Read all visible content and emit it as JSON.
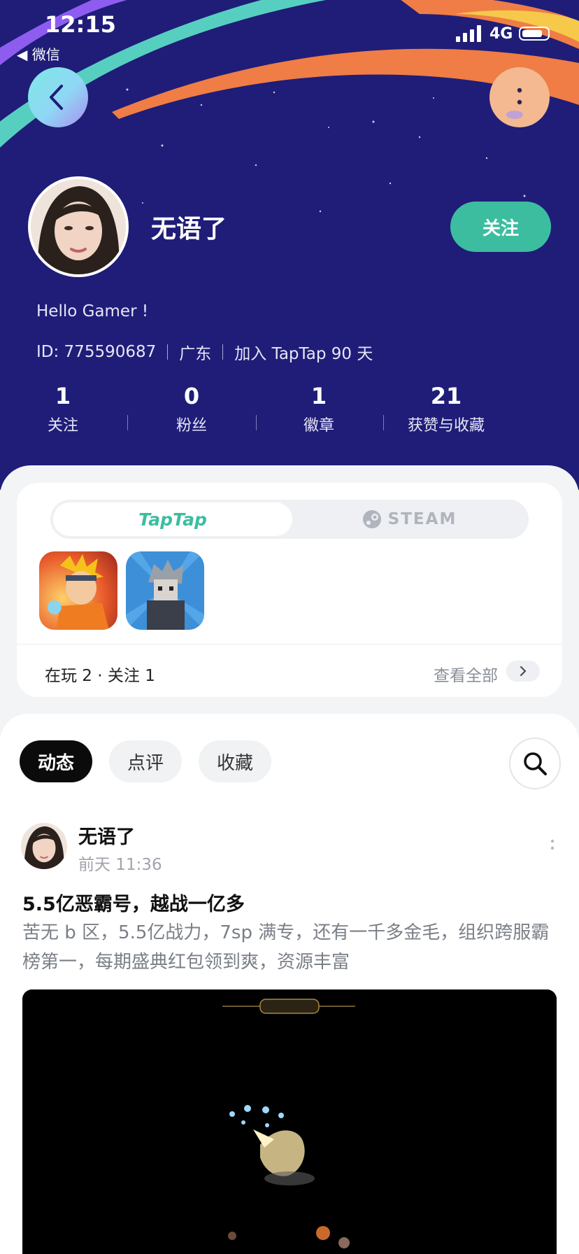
{
  "status_bar": {
    "time": "12:15",
    "back_app": "◀ 微信",
    "network": "4G"
  },
  "header": {
    "back_icon": "chevron-left-icon",
    "more_icon": "more-vertical-icon"
  },
  "profile": {
    "nickname": "无语了",
    "follow_label": "关注",
    "bio": "Hello Gamer !",
    "id_text": "ID: 775590687",
    "location": "广东",
    "joined": "加入 TapTap 90 天"
  },
  "stats": [
    {
      "value": "1",
      "label": "关注"
    },
    {
      "value": "0",
      "label": "粉丝"
    },
    {
      "value": "1",
      "label": "徽章"
    },
    {
      "value": "21",
      "label": "获赞与收藏"
    }
  ],
  "games": {
    "tabs": [
      {
        "label": "TapTap",
        "active": true
      },
      {
        "label": "STEAM",
        "active": false
      }
    ],
    "icons": [
      "naruto-game-icon",
      "pixel-warrior-game-icon"
    ],
    "summary": "在玩 2 · 关注 1",
    "see_all": "查看全部"
  },
  "feed": {
    "tabs": [
      {
        "label": "动态",
        "active": true
      },
      {
        "label": "点评",
        "active": false
      },
      {
        "label": "收藏",
        "active": false
      }
    ],
    "search_icon": "search-icon"
  },
  "post": {
    "author": "无语了",
    "time": "前天 11:36",
    "title": "5.5亿恶霸号，越战一亿多",
    "body": "苦无 b 区，5.5亿战力，7sp 满专，还有一千多金毛，组织跨服霸榜第一，每期盛典红包领到爽，资源丰富"
  },
  "colors": {
    "hero_bg": "#1f1d78",
    "accent_green": "#3cbda0",
    "stripe_orange": "#ef7d45",
    "stripe_teal": "#57cfc0",
    "stripe_yellow": "#f6c94a"
  }
}
